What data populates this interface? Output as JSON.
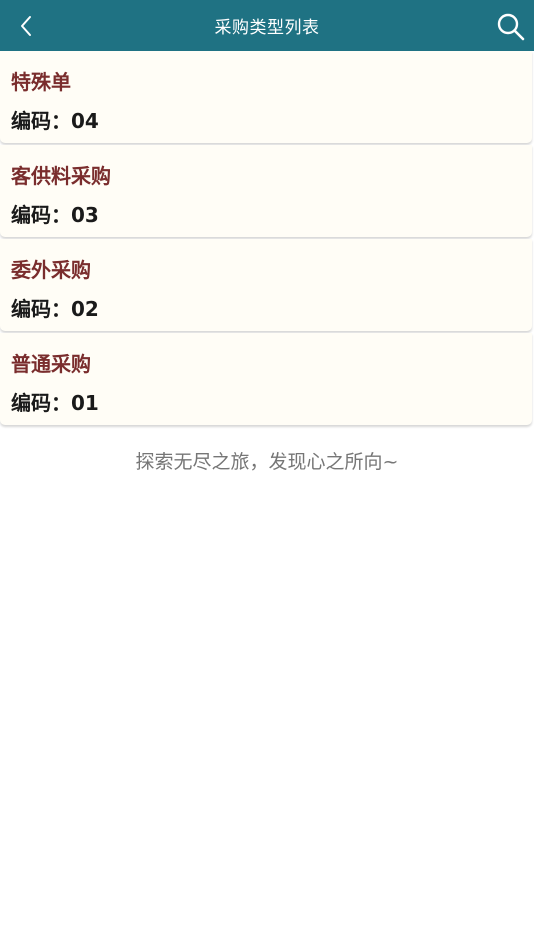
{
  "header": {
    "title": "采购类型列表",
    "back_icon": "chevron-left-icon",
    "search_icon": "search-icon",
    "bg_color": "#1f7283"
  },
  "list": {
    "code_label": "编码：",
    "items": [
      {
        "name": "特殊单",
        "code": "04"
      },
      {
        "name": "客供料采购",
        "code": "03"
      },
      {
        "name": "委外采购",
        "code": "02"
      },
      {
        "name": "普通采购",
        "code": "01"
      }
    ]
  },
  "footer": {
    "text": "探索无尽之旅，发现心之所向~"
  }
}
